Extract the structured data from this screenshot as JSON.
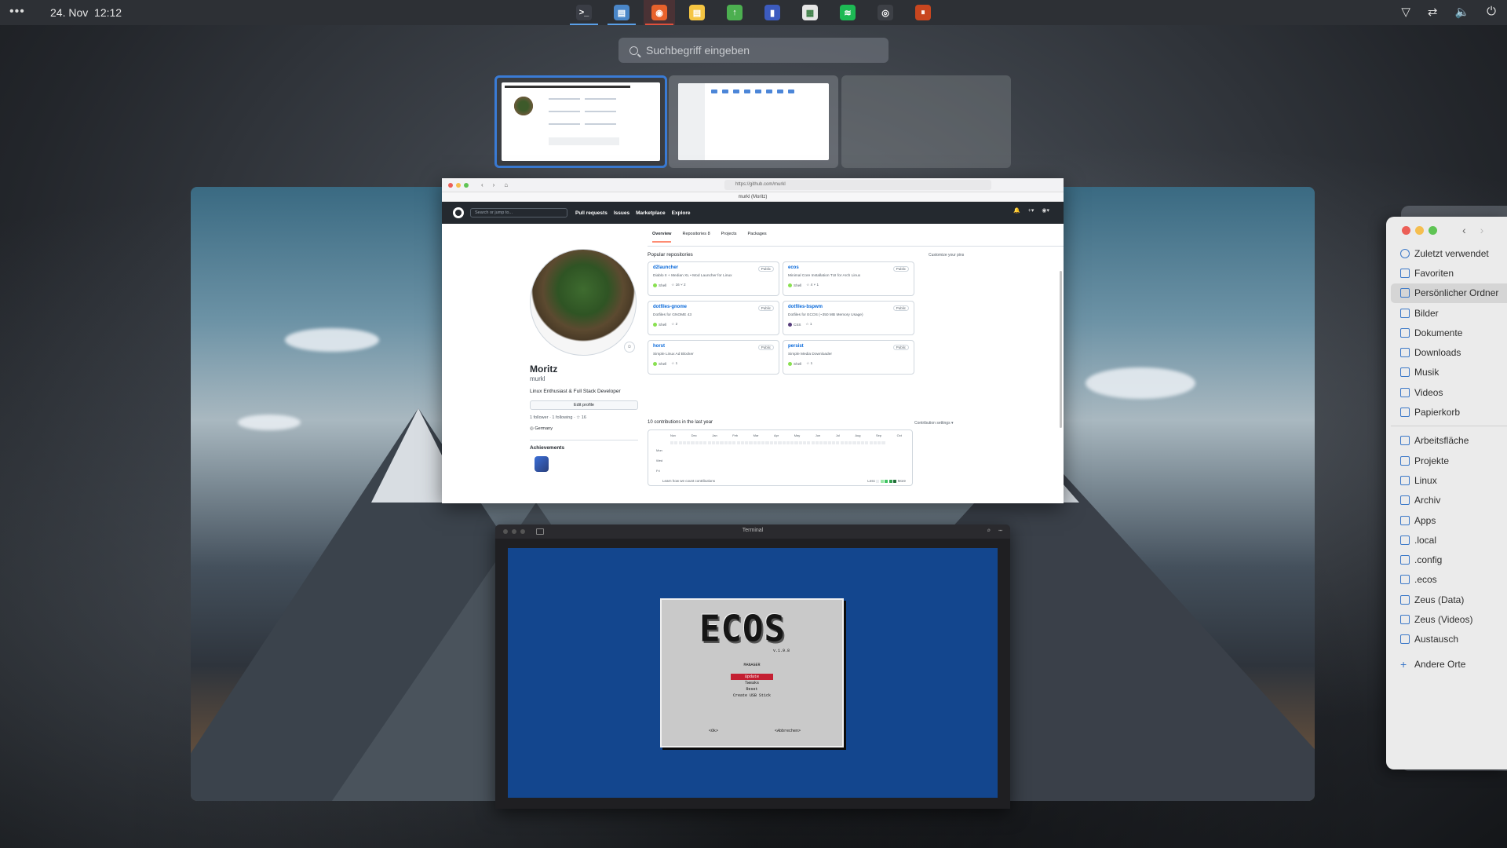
{
  "topbar": {
    "menu": "•••",
    "date": "24. Nov",
    "time": "12:12",
    "dock": [
      {
        "name": "terminal",
        "glyph": ">_",
        "color": "#3a3d45",
        "active": "blue"
      },
      {
        "name": "files",
        "glyph": "▤",
        "color": "#4a86c8",
        "active": "blue"
      },
      {
        "name": "firefox",
        "glyph": "◉",
        "color": "#e8622c",
        "active": "red"
      },
      {
        "name": "notes",
        "glyph": "▤",
        "color": "#f5c542",
        "active": ""
      },
      {
        "name": "update",
        "glyph": "↑",
        "color": "#4caf50",
        "active": ""
      },
      {
        "name": "bookmark",
        "glyph": "▮",
        "color": "#3c5bbf",
        "active": ""
      },
      {
        "name": "calendar",
        "glyph": "▦",
        "color": "#e6e6e6",
        "active": ""
      },
      {
        "name": "spotify",
        "glyph": "≋",
        "color": "#1db954",
        "active": ""
      },
      {
        "name": "steam",
        "glyph": "◎",
        "color": "#3d4046",
        "active": ""
      },
      {
        "name": "audio",
        "glyph": "⏸",
        "color": "#c8461f",
        "active": ""
      }
    ],
    "tray": [
      "▽",
      "⇄",
      "🔈",
      "⏻"
    ]
  },
  "search": {
    "placeholder": "Suchbegriff eingeben"
  },
  "browser": {
    "url": "https://github.com/murkl",
    "tab_title": "murkl (Moritz)",
    "gh_search": "Search or jump to...",
    "gh_nav": [
      "Pull requests",
      "Issues",
      "Marketplace",
      "Explore"
    ],
    "tabs": [
      "Overview",
      "Repositories 8",
      "Projects",
      "Packages"
    ],
    "profile": {
      "name": "Moritz",
      "login": "murkl",
      "bio": "Linux Enthusiast & Full Stack Developer",
      "edit": "Edit profile",
      "follow": "1 follower · 1 following · ☆ 16",
      "location": "Germany",
      "achievements": "Achievements"
    },
    "popular_heading": "Popular repositories",
    "customize": "Customize your pins",
    "repos": [
      {
        "name": "d2launcher",
        "vis": "Public",
        "desc": "Diablo II + Median XL • Mod Launcher for Linux",
        "lang": "Shell",
        "lang_color": "#89e051",
        "meta": "☆ 16   ⑂ 2"
      },
      {
        "name": "ecos",
        "vis": "Public",
        "desc": "Minimal Core Installation TUI for Arch Linux",
        "lang": "Shell",
        "lang_color": "#89e051",
        "meta": "☆ 4   ⑂ 1"
      },
      {
        "name": "dotfiles-gnome",
        "vis": "Public",
        "desc": "Dotfiles for GNOME 43",
        "lang": "Shell",
        "lang_color": "#89e051",
        "meta": "☆ 2"
      },
      {
        "name": "dotfiles-bspwm",
        "vis": "Public",
        "desc": "Dotfiles for ECOS (~350 MB Memory Usage)",
        "lang": "CSS",
        "lang_color": "#563d7c",
        "meta": "☆ 1"
      },
      {
        "name": "horst",
        "vis": "Public",
        "desc": "Simple Linux Ad Blocker",
        "lang": "Shell",
        "lang_color": "#89e051",
        "meta": "☆ 1"
      },
      {
        "name": "persist",
        "vis": "Public",
        "desc": "Simple Media Downloader",
        "lang": "Shell",
        "lang_color": "#89e051",
        "meta": "☆ 1"
      }
    ],
    "contrib_heading": "10 contributions in the last year",
    "contrib_settings": "Contribution settings ▾",
    "months": [
      "Nov",
      "Dec",
      "Jan",
      "Feb",
      "Mar",
      "Apr",
      "May",
      "Jun",
      "Jul",
      "Aug",
      "Sep",
      "Oct",
      "Nov"
    ],
    "days": [
      "Mon",
      "Wed",
      "Fri"
    ],
    "contrib_learn": "Learn how we count contributions",
    "legend_less": "Less",
    "legend_more": "More"
  },
  "terminal": {
    "title": "Terminal",
    "logo": "ECOS",
    "version": "v.1.9.8",
    "manager": "MANAGER",
    "menu": [
      "Update",
      "Tweaks",
      "Reset",
      "Create USB Stick"
    ],
    "ok": "<Ok>",
    "cancel": "<Abbrechen>"
  },
  "files": {
    "nav_back": "‹",
    "nav_forward": "›",
    "places": [
      {
        "label": "Zuletzt verwendet",
        "icon": "clock-icon",
        "selected": false
      },
      {
        "label": "Favoriten",
        "icon": "star-icon",
        "selected": false
      },
      {
        "label": "Persönlicher Ordner",
        "icon": "home-icon",
        "selected": true
      },
      {
        "label": "Bilder",
        "icon": "image-icon",
        "selected": false
      },
      {
        "label": "Dokumente",
        "icon": "document-icon",
        "selected": false
      },
      {
        "label": "Downloads",
        "icon": "download-icon",
        "selected": false
      },
      {
        "label": "Musik",
        "icon": "music-icon",
        "selected": false
      },
      {
        "label": "Videos",
        "icon": "video-icon",
        "selected": false
      },
      {
        "label": "Papierkorb",
        "icon": "trash-icon",
        "selected": false
      }
    ],
    "bookmarks": [
      {
        "label": "Arbeitsfläche",
        "icon": "desktop-icon"
      },
      {
        "label": "Projekte",
        "icon": "folder-icon"
      },
      {
        "label": "Linux",
        "icon": "folder-icon"
      },
      {
        "label": "Archiv",
        "icon": "folder-icon"
      },
      {
        "label": "Apps",
        "icon": "folder-icon"
      },
      {
        "label": ".local",
        "icon": "folder-icon"
      },
      {
        "label": ".config",
        "icon": "folder-icon"
      },
      {
        "label": ".ecos",
        "icon": "folder-icon"
      },
      {
        "label": "Zeus (Data)",
        "icon": "folder-icon"
      },
      {
        "label": "Zeus (Videos)",
        "icon": "folder-icon"
      },
      {
        "label": "Austausch",
        "icon": "folder-icon"
      }
    ],
    "other": "Andere Orte"
  }
}
